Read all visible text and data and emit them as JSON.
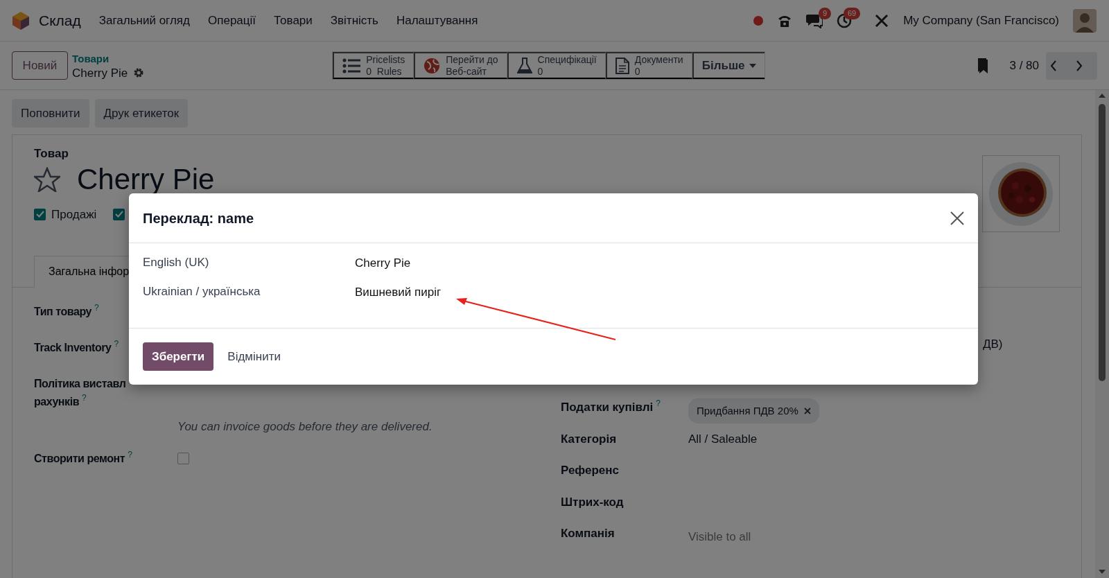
{
  "navbar": {
    "app": "Склад",
    "menu": [
      "Загальний огляд",
      "Операції",
      "Товари",
      "Звітність",
      "Налаштування"
    ],
    "badges": [
      {
        "kind": "chat",
        "count": "9"
      },
      {
        "kind": "activity",
        "count": "69"
      }
    ],
    "company": "My Company (San Francisco)"
  },
  "control_panel": {
    "new_button": "Новий",
    "breadcrumb": "Товари",
    "record": "Cherry Pie",
    "smart_buttons": [
      {
        "kind": "list",
        "line1": "Pricelists",
        "line2": "0  Rules"
      },
      {
        "kind": "globe",
        "line1": "Перейти до",
        "line2": "Веб-сайт"
      },
      {
        "kind": "flask",
        "line1": "Специфікації",
        "line2": "0"
      },
      {
        "kind": "document",
        "line1": "Документи",
        "line2": "0"
      }
    ],
    "more": "Більше",
    "pager": "3 / 80"
  },
  "action_buttons": [
    "Поповнити",
    "Друк етикеток"
  ],
  "form": {
    "label": "Товар",
    "title": "Cherry Pie",
    "favorite": false,
    "options": [
      {
        "label": "Продажі",
        "checked": true
      },
      {
        "checked": true
      }
    ],
    "tabs": [
      {
        "label": "Загальна інфор",
        "selected": true
      }
    ],
    "left_fields": [
      {
        "label_lines": [
          "Тип товару"
        ],
        "help": "?"
      },
      {
        "label_lines": [
          "Track Inventory"
        ],
        "help": "?"
      },
      {
        "label_lines": [
          "Політика виставл",
          "рахунків"
        ],
        "help": "?",
        "note": "You can invoice goods before they are delivered."
      },
      {
        "label_lines": [
          "Створити ремонт"
        ],
        "help": "?",
        "kind": "checkbox",
        "checked": false
      }
    ],
    "right_fields": [
      {
        "kind": "fragment",
        "value": "ДВ)"
      },
      {
        "label": "Податки купівлі",
        "help": "?",
        "tags": [
          "Придбання ПДВ 20%"
        ]
      },
      {
        "label": "Категорія",
        "value": "All / Saleable"
      },
      {
        "label": "Референс"
      },
      {
        "label": "Штрих-код"
      },
      {
        "label": "Компанія",
        "placeholder": "Visible to all"
      }
    ]
  },
  "dialog": {
    "title": "Переклад: name",
    "rows": [
      {
        "language": "English (UK)",
        "value": "Cherry Pie"
      },
      {
        "language": "Ukrainian / українська",
        "value": "Вишневий пиріг"
      }
    ],
    "save": "Зберегти",
    "cancel": "Відмінити"
  }
}
